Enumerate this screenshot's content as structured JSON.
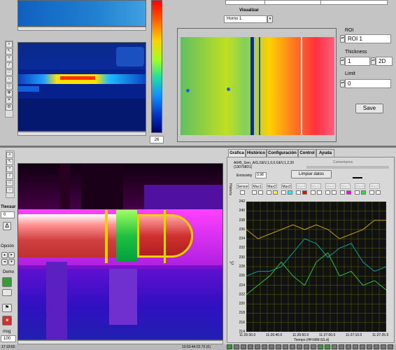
{
  "top_panel": {
    "visualizar_label": "Visualizar",
    "visualizar_value": "Horno 1",
    "colorbar_min": "26",
    "roi_label": "ROI",
    "roi_value": "ROI 1",
    "thickness_label": "Thickness",
    "thickness_value": "1",
    "thickness_mode": "2D",
    "limit_label": "Limit",
    "limit_value": "0",
    "save_label": "Save"
  },
  "left_strip": {
    "tlexsur_label": "Tlexsur",
    "value": "0",
    "opcion_label": "Opción",
    "demo_label": "Demo",
    "msg_label": "msg",
    "msg_value": "100",
    "bottom_left_text": "17:19:50"
  },
  "tabs": [
    {
      "label": "Gráfica"
    },
    {
      "label": "Histórico"
    },
    {
      "label": "Configuración"
    },
    {
      "label": "Control"
    },
    {
      "label": "Ayuda"
    }
  ],
  "grafica": {
    "device_info": "A645_Gen_A/G,GEV,1,0,0,GEV,1,2,20\n(130708D1)",
    "comentarios_label": "Comentarios",
    "emissivity_label": "Emissivity",
    "emissivity_value": "0.98",
    "clear_button": "Limpiar datos",
    "historic_label": "Historia",
    "sensor_label": "Sensor",
    "markers": [
      "Max1",
      "Max2",
      "Max3",
      "Max4",
      "Max5",
      "Max6",
      "Max7",
      "Max8",
      "Max9"
    ],
    "marker_colors": [
      "#ffffff",
      "#ffff00",
      "#00ffff",
      "#ff0000",
      "#ffffff",
      "#ffffff",
      "#ff00ff",
      "#00ff00",
      "#ffffff"
    ],
    "y_axis_label": "°C",
    "x_axis_label": "Tiempo (HH:MM:SS.d)",
    "y_ticks": [
      "242",
      "240",
      "238",
      "236",
      "234",
      "232",
      "230",
      "228",
      "226",
      "224",
      "222",
      "220",
      "218",
      "216",
      "214"
    ],
    "x_ticks": [
      "11:26:30.0",
      "11:26:40.0",
      "11:26:50.0",
      "11:27:00.0",
      "11:27:10.0",
      "11:27:25.0"
    ]
  },
  "status_bar": {
    "timestamp": "10:53:44:22.75 (0)"
  },
  "chart_data": {
    "type": "line",
    "ylabel": "°C",
    "xlabel": "Tiempo (HH:MM:SS.d)",
    "ylim": [
      214,
      242
    ],
    "x": [
      "11:26:30.0",
      "11:26:40.0",
      "11:26:50.0",
      "11:27:00.0",
      "11:27:10.0",
      "11:27:25.0"
    ],
    "series": [
      {
        "color": "#c8a000",
        "values": [
          236,
          234,
          235,
          236,
          237,
          236,
          237,
          236,
          234,
          235,
          236,
          238,
          238
        ]
      },
      {
        "color": "#00a0a0",
        "values": [
          226,
          227,
          227,
          228,
          231,
          234,
          233,
          230,
          232,
          233,
          229,
          227,
          228
        ]
      },
      {
        "color": "#30c030",
        "values": [
          222,
          224,
          226,
          229,
          226,
          224,
          229,
          231,
          226,
          227,
          224,
          225,
          223
        ]
      }
    ]
  }
}
